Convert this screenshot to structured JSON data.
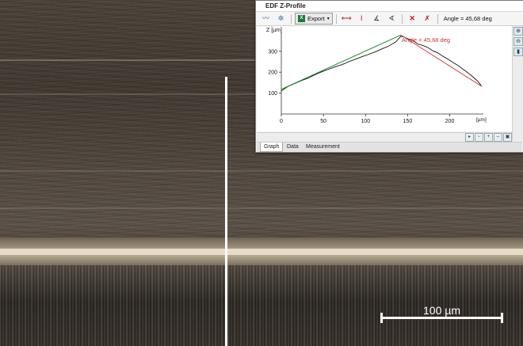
{
  "window": {
    "title": "EDF Z-Profile",
    "toolbar": {
      "export_label": "Export",
      "angle_readout": "Angle = 45,68 deg",
      "icons": [
        "profile-line-icon",
        "settings-gear-icon",
        "excel-icon",
        "dropdown-arrow-icon",
        "horizontal-measure-icon",
        "vertical-measure-icon",
        "angle-measure-icon",
        "angle-measure-alt-icon",
        "delete-icon",
        "clear-all-icon"
      ]
    },
    "tabs": [
      {
        "label": "Graph",
        "active": true
      },
      {
        "label": "Data",
        "active": false
      },
      {
        "label": "Measurement",
        "active": false
      }
    ],
    "side_buttons": [
      "zoom-in-icon",
      "zoom-out-icon",
      "fit-icon"
    ],
    "bottom_buttons": [
      "scroll-right-icon",
      "zoom-minus-icon",
      "zoom-plus-icon",
      "fit-width-icon",
      "fit-all-icon"
    ]
  },
  "chart_data": {
    "type": "line",
    "ylabel": "Z [µm]",
    "xlabel": "[µm]",
    "xlim": [
      0,
      240
    ],
    "ylim": [
      0,
      390
    ],
    "x_ticks": [
      0,
      50,
      100,
      150,
      200
    ],
    "y_ticks": [
      100,
      200,
      300
    ],
    "annotation": "Angle = 45,68 deg",
    "series": [
      {
        "color": "#111111",
        "x": [
          0,
          8,
          16,
          24,
          32,
          40,
          48,
          56,
          64,
          72,
          80,
          88,
          96,
          104,
          112,
          120,
          128,
          136,
          142,
          146,
          150,
          156,
          162,
          168,
          174,
          180,
          186,
          192,
          198,
          204,
          210,
          216,
          222,
          228,
          234,
          238
        ],
        "y": [
          110,
          132,
          146,
          160,
          172,
          188,
          202,
          214,
          226,
          236,
          250,
          262,
          274,
          286,
          298,
          312,
          326,
          345,
          372,
          368,
          360,
          352,
          335,
          328,
          318,
          302,
          292,
          276,
          262,
          246,
          232,
          214,
          196,
          176,
          154,
          132
        ]
      },
      {
        "color": "#1a8a2a",
        "x": [
          0,
          142
        ],
        "y": [
          118,
          378
        ]
      },
      {
        "color": "#d04040",
        "x": [
          142,
          238
        ],
        "y": [
          378,
          132
        ]
      }
    ]
  },
  "scalebar": {
    "label": "100 µm"
  }
}
